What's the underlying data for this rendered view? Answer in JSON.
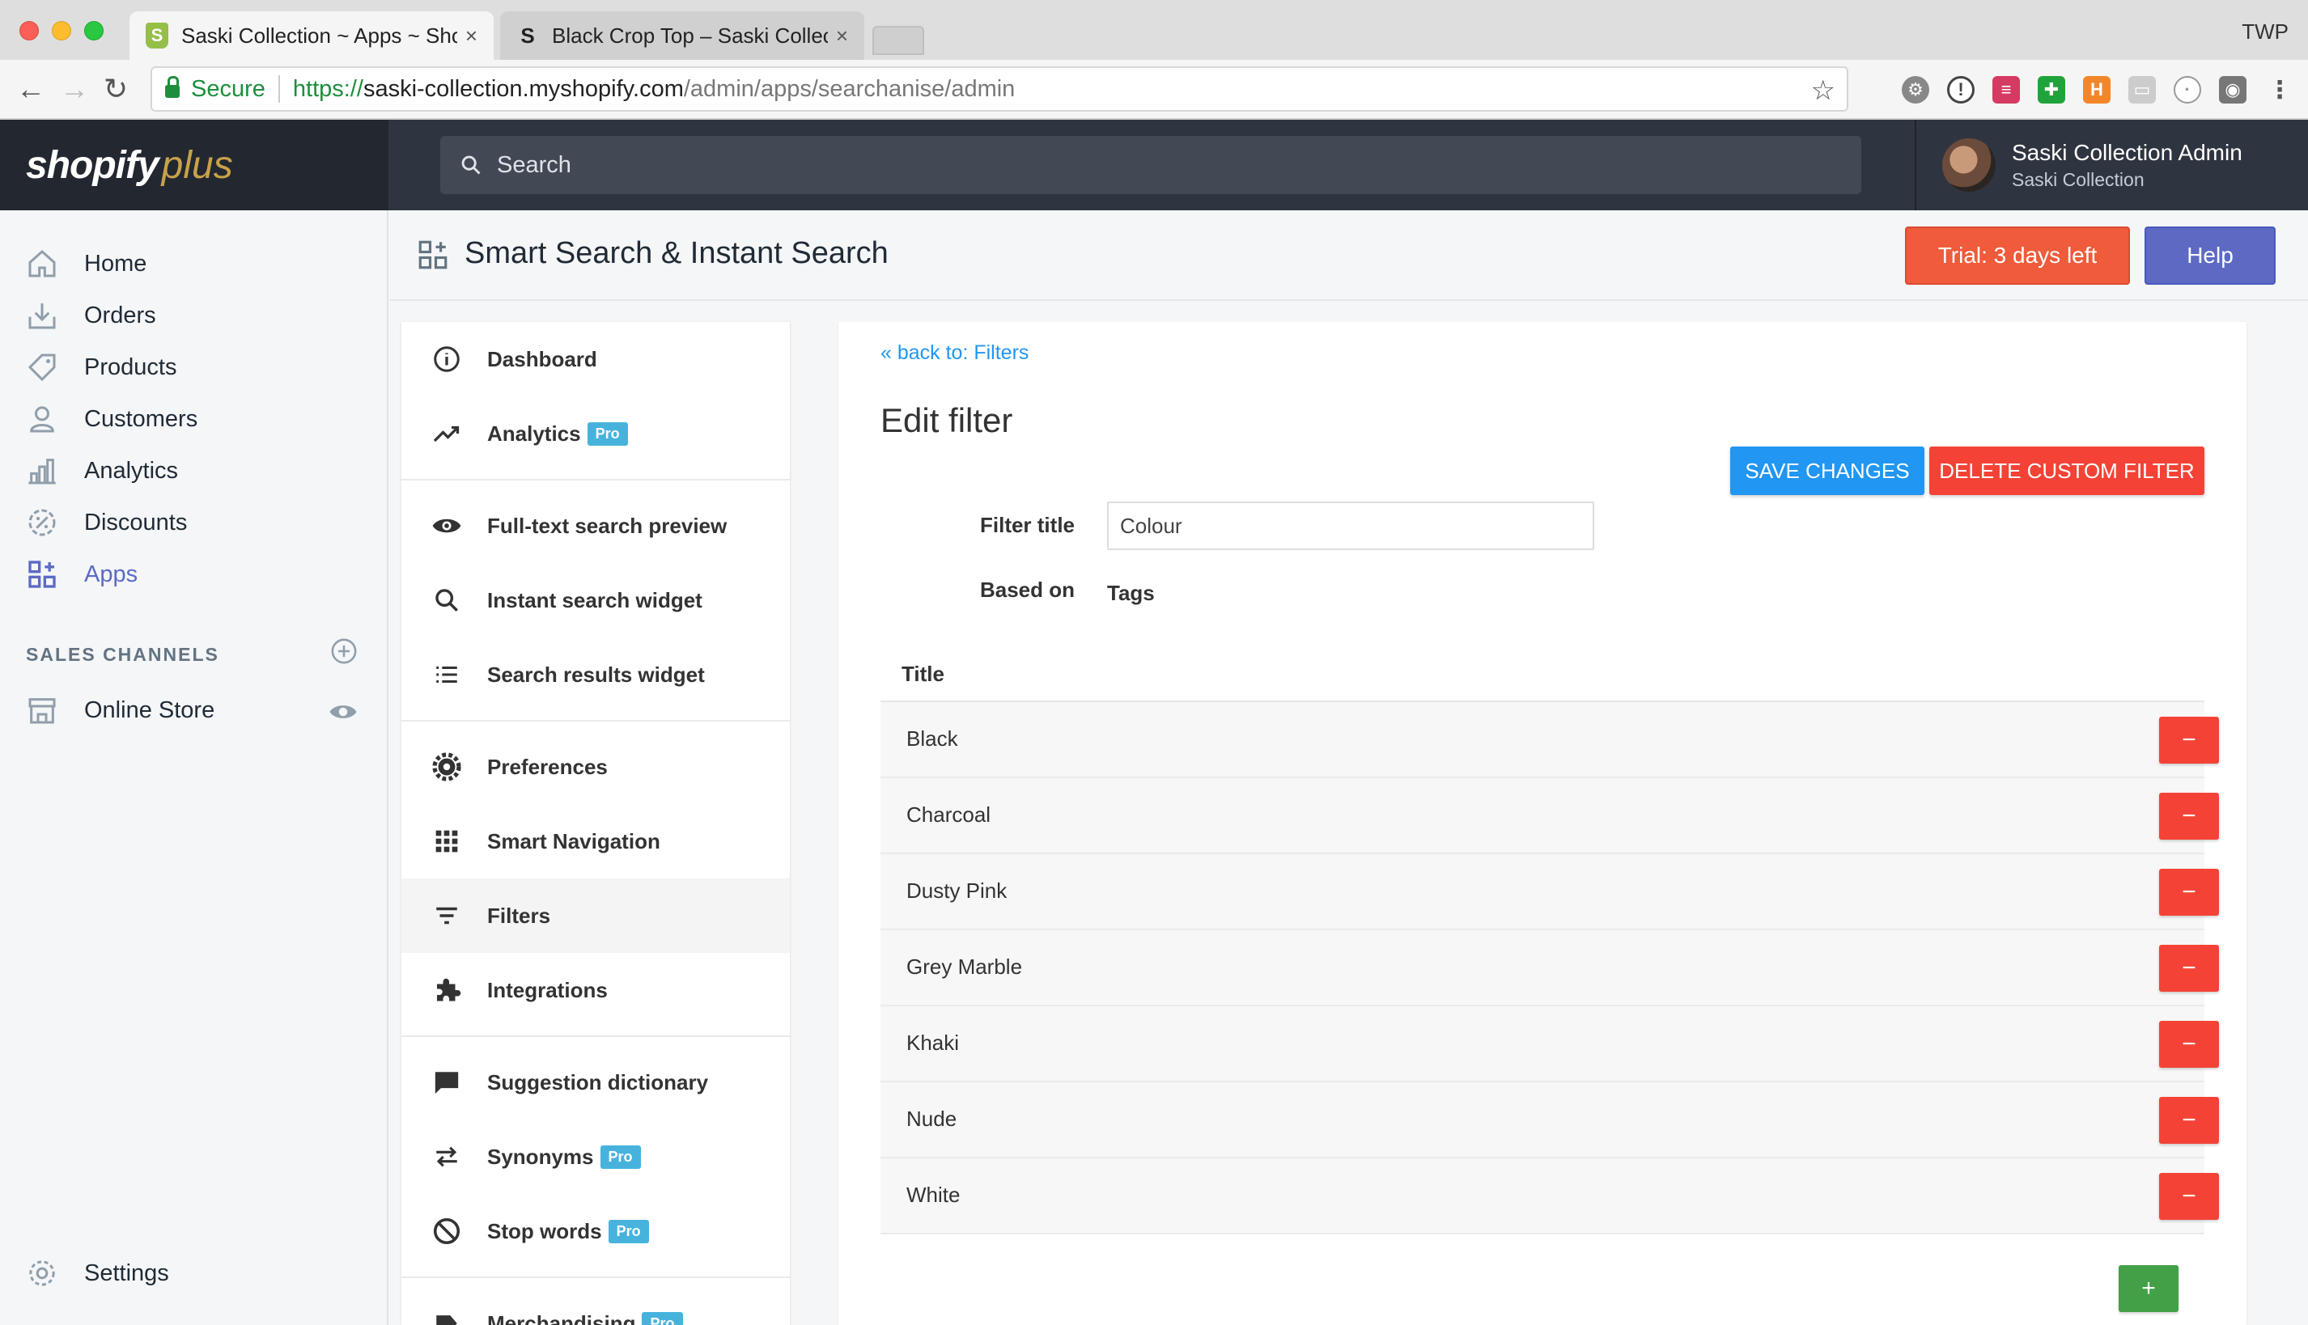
{
  "browser": {
    "tabs": [
      {
        "title": "Saski Collection ~ Apps ~ Shopify",
        "favicon": "shopify-bag-icon",
        "active": true
      },
      {
        "title": "Black Crop Top – Saski Collection",
        "favicon": "s-letter-icon",
        "active": false
      }
    ],
    "profile": "TWP",
    "secure_label": "Secure",
    "url": {
      "scheme": "https://",
      "host": "saski-collection.myshopify.com",
      "path": "/admin/apps/searchanise/admin"
    }
  },
  "shopify": {
    "logo_main": "shopify",
    "logo_plus": "plus",
    "search_placeholder": "Search",
    "user_name": "Saski Collection Admin",
    "user_shop": "Saski Collection"
  },
  "leftnav": {
    "items": [
      {
        "label": "Home",
        "icon": "home-icon"
      },
      {
        "label": "Orders",
        "icon": "orders-icon"
      },
      {
        "label": "Products",
        "icon": "tag-icon"
      },
      {
        "label": "Customers",
        "icon": "person-icon"
      },
      {
        "label": "Analytics",
        "icon": "bar-chart-icon"
      },
      {
        "label": "Discounts",
        "icon": "discount-icon"
      },
      {
        "label": "Apps",
        "icon": "apps-icon",
        "active": true
      }
    ],
    "sales_channels_label": "SALES CHANNELS",
    "online_store": "Online Store",
    "settings": "Settings"
  },
  "app_header": {
    "title": "Smart Search & Instant Search",
    "trial": "Trial: 3 days left",
    "help": "Help"
  },
  "app_sidebar": {
    "pro_badge": "Pro",
    "items": [
      {
        "label": "Dashboard",
        "icon": "info-icon"
      },
      {
        "label": "Analytics",
        "icon": "trending-up-icon",
        "pro": true
      },
      {
        "label": "Full-text search preview",
        "icon": "eye-icon"
      },
      {
        "label": "Instant search widget",
        "icon": "search-icon"
      },
      {
        "label": "Search results widget",
        "icon": "list-icon"
      },
      {
        "label": "Preferences",
        "icon": "gear-icon"
      },
      {
        "label": "Smart Navigation",
        "icon": "grid-icon"
      },
      {
        "label": "Filters",
        "icon": "filter-icon",
        "active": true
      },
      {
        "label": "Integrations",
        "icon": "puzzle-icon"
      },
      {
        "label": "Suggestion dictionary",
        "icon": "chat-icon"
      },
      {
        "label": "Synonyms",
        "icon": "swap-icon",
        "pro": true
      },
      {
        "label": "Stop words",
        "icon": "block-icon",
        "pro": true
      },
      {
        "label": "Merchandising",
        "icon": "label-icon",
        "pro": true
      }
    ]
  },
  "editor": {
    "back_link": "« back to: Filters",
    "title": "Edit filter",
    "save_button": "SAVE CHANGES",
    "delete_button": "DELETE CUSTOM FILTER",
    "filter_title_label": "Filter title",
    "filter_title_value": "Colour",
    "based_on_label": "Based on",
    "based_on_value": "Tags",
    "table_header": "Title",
    "remove_symbol": "−",
    "add_symbol": "+",
    "values": [
      "Black",
      "Charcoal",
      "Dusty Pink",
      "Grey Marble",
      "Khaki",
      "Nude",
      "White"
    ]
  },
  "colors": {
    "accent": "#5c6ac4",
    "trial": "#ef5b3b",
    "save": "#2196f3",
    "delete": "#f44336",
    "add": "#43a047",
    "pro": "#47b3dd"
  }
}
